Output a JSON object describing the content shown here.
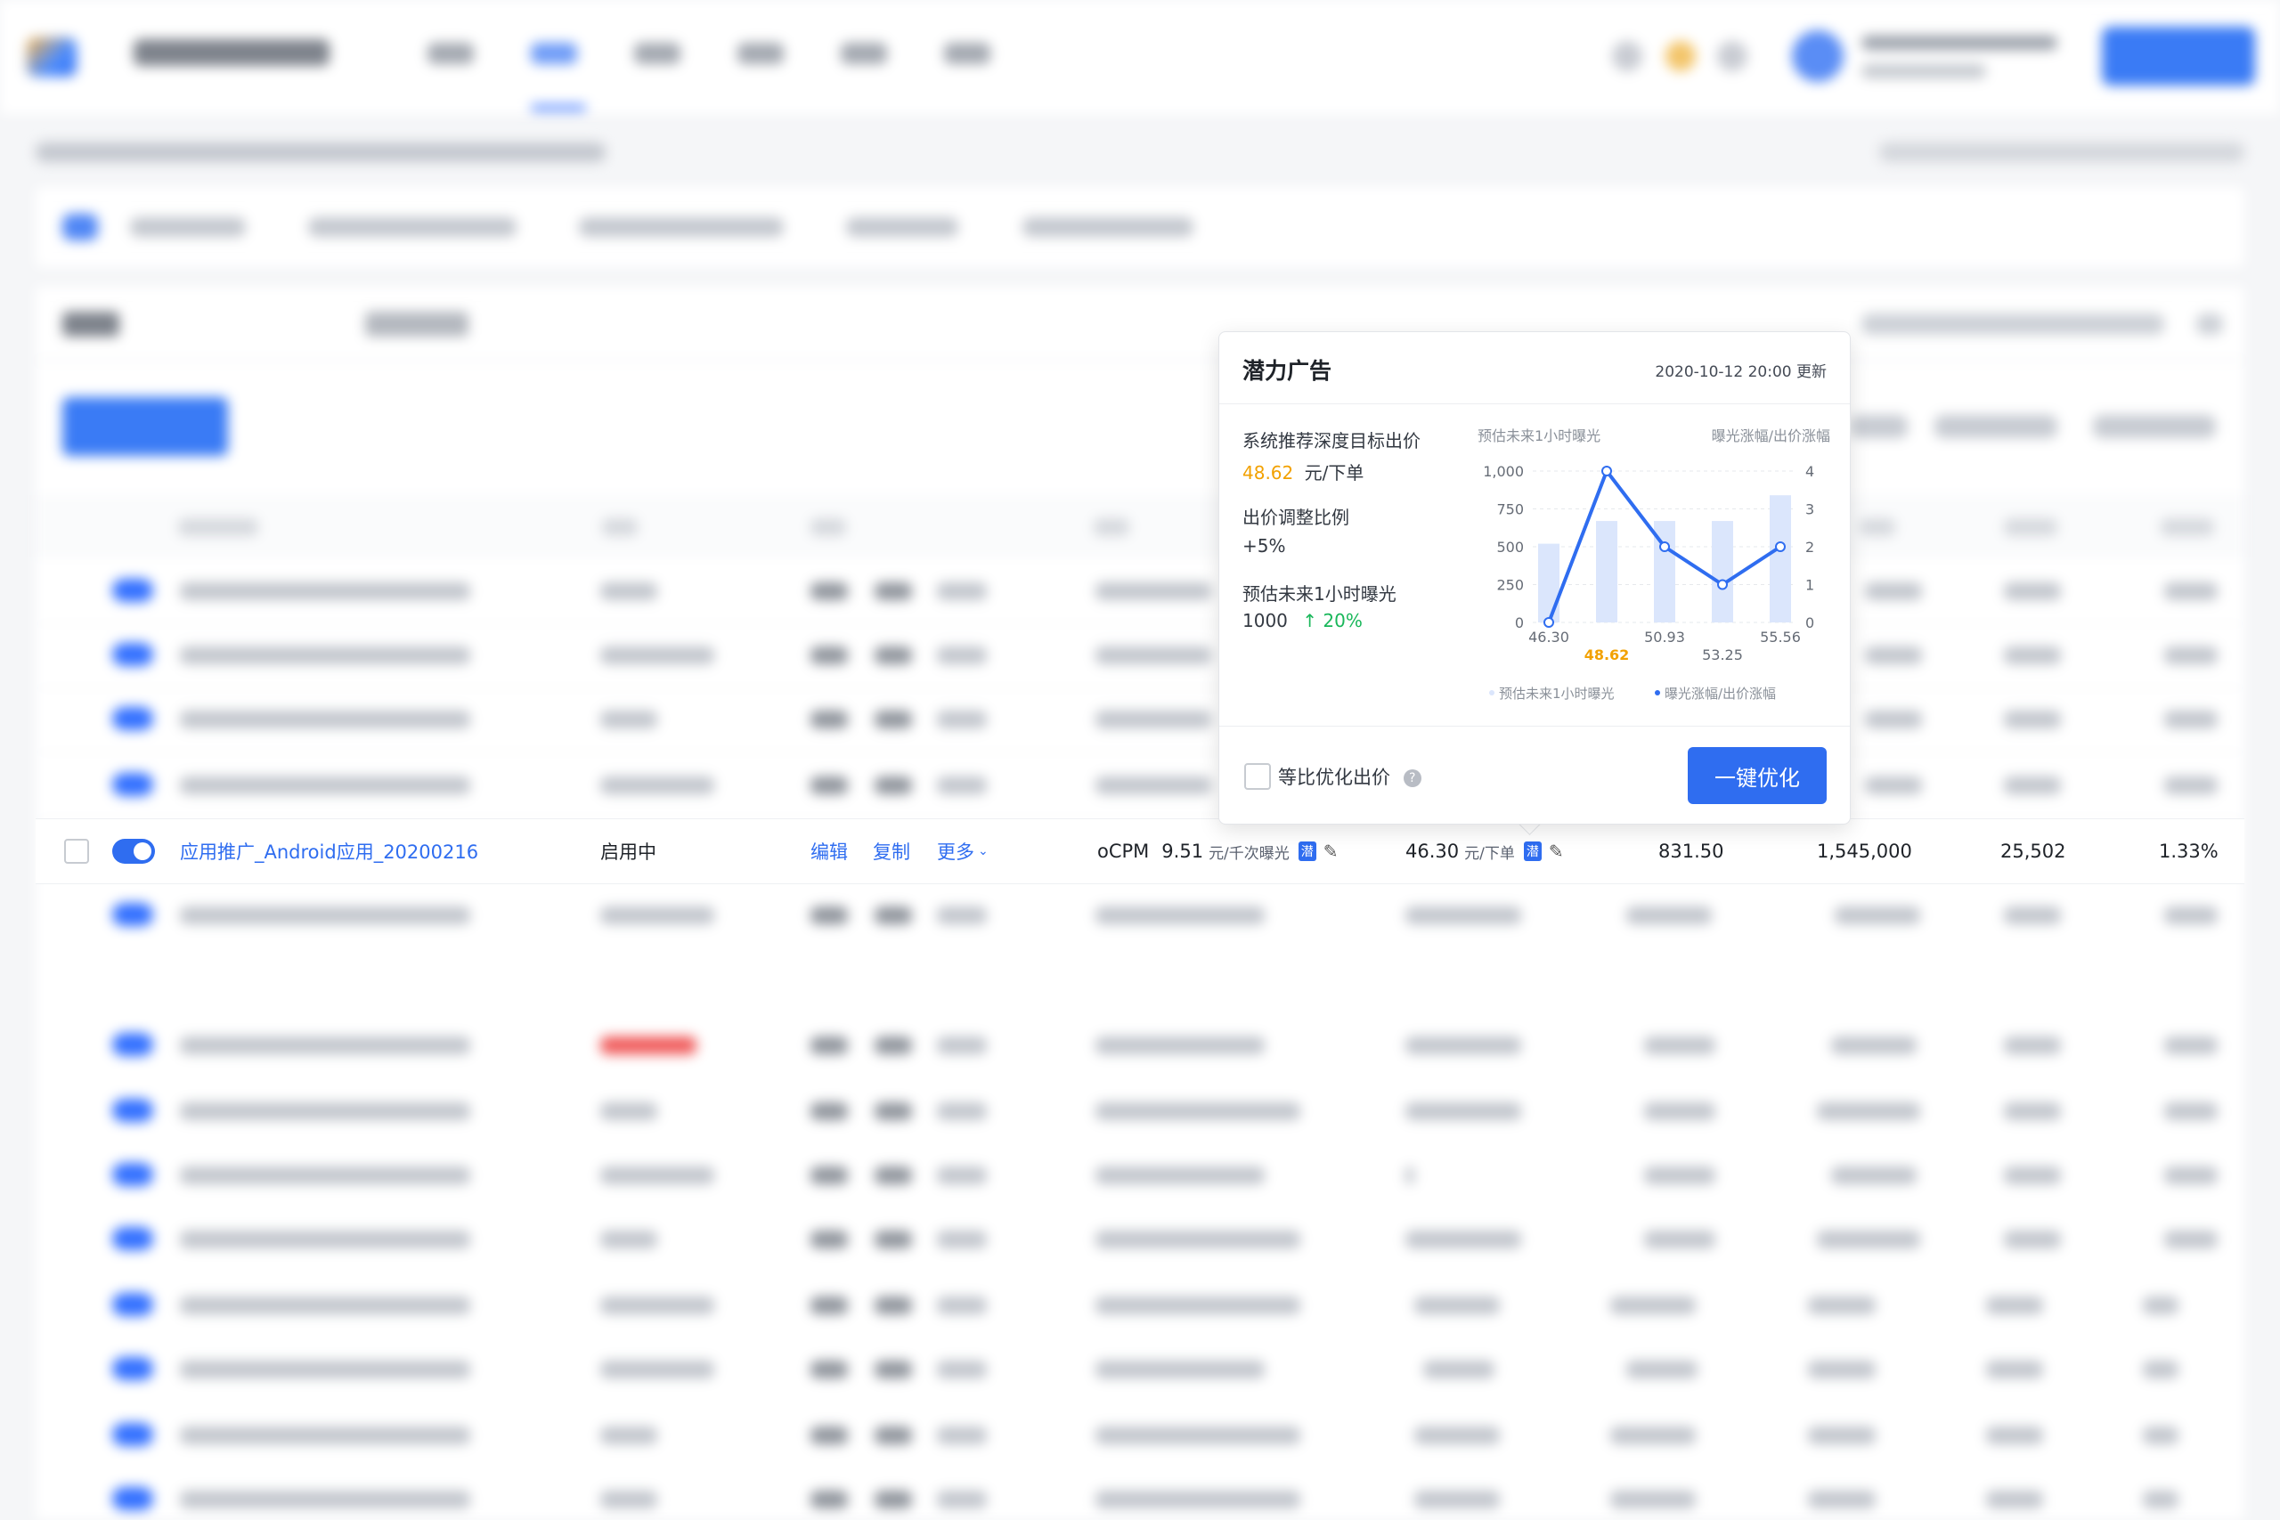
{
  "row": {
    "name": "应用推广_Android应用_20200216",
    "status": "启用中",
    "actions": {
      "edit": "编辑",
      "copy": "复制",
      "more": "更多"
    },
    "bid_type": "oCPM",
    "bid_value": "9.51",
    "bid_unit": "元/千次曝光",
    "potential_tag": "潜",
    "deep_bid_value": "46.30",
    "deep_bid_unit": "元/下单",
    "metric1": "831.50",
    "metric2": "1,545,000",
    "metric3": "25,502",
    "metric4": "1.33%"
  },
  "popover": {
    "title": "潜力广告",
    "update_time": "2020-10-12 20:00 更新",
    "recommend_label": "系统推荐深度目标出价",
    "recommend_value": "48.62",
    "recommend_unit": "元/下单",
    "ratio_label": "出价调整比例",
    "ratio_value": "+5%",
    "forecast_label": "预估未来1小时曝光",
    "forecast_value": "1000",
    "forecast_arrow": "↑",
    "forecast_change": "20%",
    "checkbox_label": "等比优化出价",
    "help_icon": "?",
    "button_label": "一键优化"
  },
  "chart_data": {
    "type": "bar",
    "categories": [
      "46.30",
      "48.62",
      "50.93",
      "53.25",
      "55.56"
    ],
    "highlight_category": "48.62",
    "left_axis_title": "预估未来1小时曝光",
    "right_axis_title": "曝光涨幅/出价涨幅",
    "left_ticks": [
      "1,000",
      "750",
      "500",
      "250",
      "0"
    ],
    "right_ticks": [
      "4",
      "3",
      "2",
      "1",
      "0"
    ],
    "ylim_left": [
      0,
      1000
    ],
    "ylim_right": [
      0,
      4
    ],
    "series": [
      {
        "name": "预估未来1小时曝光",
        "type": "bar",
        "axis": "left",
        "values": [
          520,
          670,
          670,
          670,
          840
        ]
      },
      {
        "name": "曝光涨幅/出价涨幅",
        "type": "line",
        "axis": "right",
        "values": [
          0,
          4,
          2,
          1,
          2
        ]
      }
    ],
    "bar_color": "#dbe6fc",
    "line_color": "#2f6df0",
    "highlight_color": "#f2a100",
    "legend_position": "bottom"
  }
}
